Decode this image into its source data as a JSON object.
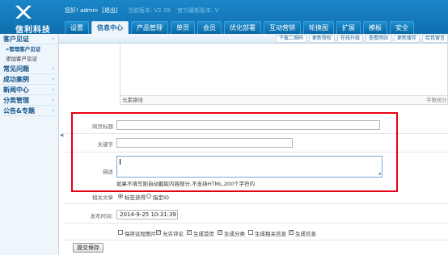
{
  "header": {
    "logo_text": "信利科技",
    "greeting_prefix": "您好! ",
    "username": "admin",
    "logout": "[退出]",
    "current_version": "当前版本: V2.39",
    "latest_version": "官方最新版本: V"
  },
  "nav": {
    "tabs": [
      "设置",
      "信息中心",
      "产品管理",
      "单页",
      "会员",
      "优化部署",
      "互动营销",
      "轮换图",
      "扩展",
      "模板",
      "安全"
    ],
    "active": "信息中心"
  },
  "toolbar": {
    "links": [
      "下载二维码",
      "更新授权",
      "在线升级",
      "查看网站",
      "更新缓存",
      "给我留言"
    ]
  },
  "sidebar": {
    "items": [
      {
        "label": "客户见证",
        "subs": [
          {
            "label": "»管理客户见证",
            "active": true
          },
          {
            "label": "添加客户见证",
            "active": false
          }
        ]
      },
      {
        "label": "常见问题",
        "subs": []
      },
      {
        "label": "成功案例",
        "subs": []
      },
      {
        "label": "新闻中心",
        "subs": []
      },
      {
        "label": "分类管理",
        "subs": []
      },
      {
        "label": "公告&专题",
        "subs": []
      }
    ]
  },
  "editor": {
    "path_label": "元素路径",
    "word_count_label": "字数统计"
  },
  "form": {
    "page_title_label": "网页标题",
    "page_title_value": "",
    "keywords_label": "关键字",
    "keywords_value": "",
    "description_label": "描述",
    "description_hint": "如果不填写则自动截取内容部分,不支持HTML,200个字符内",
    "related_label": "相关文章",
    "related_options": [
      {
        "label": "标签获得",
        "checked": true
      },
      {
        "label": "指定ID",
        "checked": false
      }
    ],
    "publish_time_label": "发布时间:",
    "publish_time_value": "2014-9-25 10:31:39",
    "checkboxes": [
      {
        "label": "保存远程图片",
        "checked": false
      },
      {
        "label": "允许评论",
        "checked": true
      },
      {
        "label": "生成首页",
        "checked": true
      },
      {
        "label": "生成分类",
        "checked": true
      },
      {
        "label": "生成相关信息",
        "checked": false
      },
      {
        "label": "生成信息",
        "checked": true
      }
    ],
    "submit_label": "提交保存"
  },
  "colors": {
    "header_blue": "#1480c0",
    "highlight_red": "#e60012"
  }
}
